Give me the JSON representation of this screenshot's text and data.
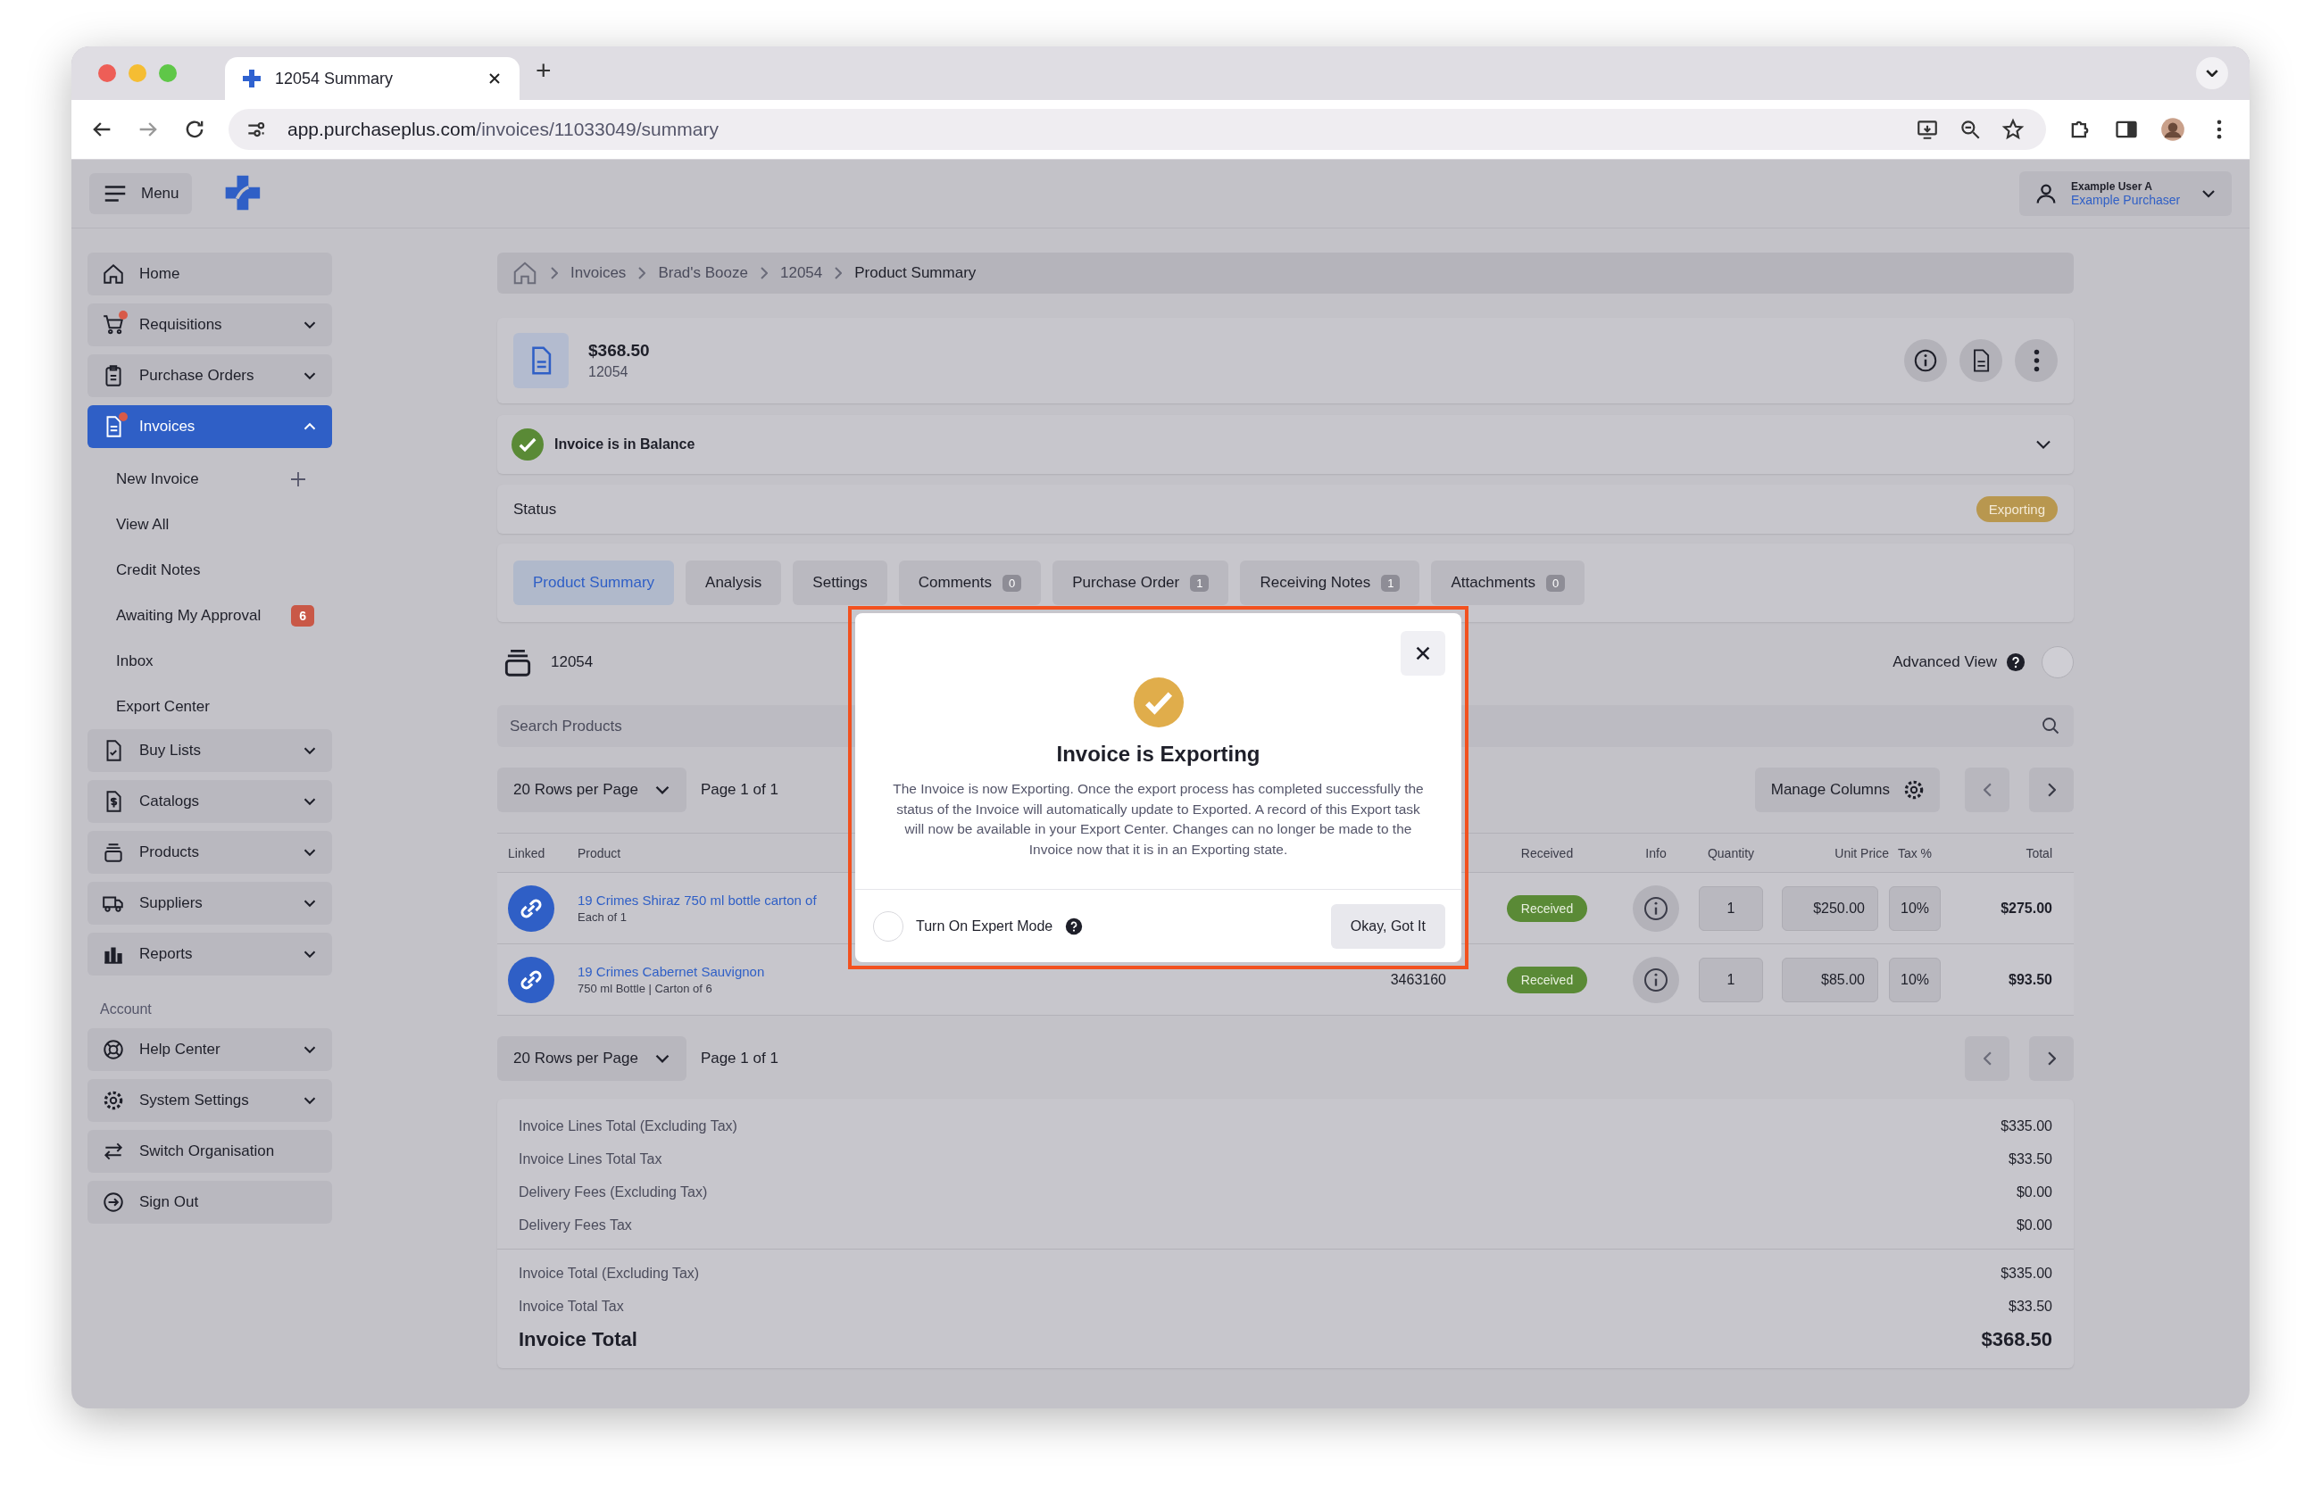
{
  "browser": {
    "tab_title": "12054 Summary",
    "new_tab": "+",
    "url_host": "app.purchaseplus.com",
    "url_path": "/invoices/11033049/summary"
  },
  "header": {
    "menu_label": "Menu",
    "user_name": "Example User A",
    "user_role": "Example Purchaser"
  },
  "sidebar": {
    "items": [
      {
        "label": "Home",
        "kind": "link",
        "selected": false,
        "alert": false
      },
      {
        "label": "Requisitions",
        "kind": "group",
        "expanded": false,
        "selected": false,
        "alert": true
      },
      {
        "label": "Purchase Orders",
        "kind": "group",
        "expanded": false,
        "selected": false,
        "alert": false
      },
      {
        "label": "Invoices",
        "kind": "group",
        "expanded": true,
        "selected": true,
        "alert": true,
        "children": [
          {
            "label": "New Invoice",
            "kind": "add"
          },
          {
            "label": "View All",
            "kind": "link"
          },
          {
            "label": "Credit Notes",
            "kind": "link"
          },
          {
            "label": "Awaiting My Approval",
            "kind": "link",
            "badge": "6"
          },
          {
            "label": "Inbox",
            "kind": "link"
          },
          {
            "label": "Export Center",
            "kind": "link"
          }
        ]
      },
      {
        "label": "Buy Lists",
        "kind": "group",
        "expanded": false,
        "selected": false,
        "alert": false
      },
      {
        "label": "Catalogs",
        "kind": "group",
        "expanded": false,
        "selected": false,
        "alert": false
      },
      {
        "label": "Products",
        "kind": "group",
        "expanded": false,
        "selected": false,
        "alert": false
      },
      {
        "label": "Suppliers",
        "kind": "group",
        "expanded": false,
        "selected": false,
        "alert": false
      },
      {
        "label": "Reports",
        "kind": "group",
        "expanded": false,
        "selected": false,
        "alert": false
      }
    ],
    "account": {
      "heading": "Account",
      "items": [
        {
          "label": "Help Center",
          "kind": "group",
          "expanded": false,
          "selected": false,
          "alert": false
        },
        {
          "label": "System Settings",
          "kind": "group",
          "expanded": false,
          "selected": false,
          "alert": false
        },
        {
          "label": "Switch Organisation",
          "kind": "link",
          "selected": false,
          "alert": false
        },
        {
          "label": "Sign Out",
          "kind": "link",
          "selected": false,
          "alert": false
        }
      ]
    }
  },
  "breadcrumb": [
    "Invoices",
    "Brad's Booze",
    "12054",
    "Product Summary"
  ],
  "invoice": {
    "amount": "$368.50",
    "number": "12054"
  },
  "balance": {
    "label": "Invoice is in Balance",
    "expanded": false
  },
  "status": {
    "label": "Status",
    "badge": "Exporting"
  },
  "tabs": [
    {
      "label": "Product Summary",
      "selected": true
    },
    {
      "label": "Analysis",
      "selected": false
    },
    {
      "label": "Settings",
      "selected": false
    },
    {
      "label": "Comments",
      "count": "0",
      "selected": false
    },
    {
      "label": "Purchase Order",
      "count": "1",
      "selected": false
    },
    {
      "label": "Receiving Notes",
      "count": "1",
      "selected": false
    },
    {
      "label": "Attachments",
      "count": "0",
      "selected": false
    }
  ],
  "products": {
    "title": "12054",
    "advanced_view": {
      "label": "Advanced View",
      "on": false
    },
    "search": {
      "placeholder": "Search Products"
    },
    "pagination_top": {
      "rows": "20 Rows per Page",
      "page": "Page 1 of 1",
      "manage_columns": "Manage Columns"
    },
    "columns": [
      "Linked",
      "Product",
      "Received",
      "Info",
      "Quantity",
      "Unit Price",
      "Tax %",
      "Total"
    ],
    "rows": [
      {
        "linked": true,
        "product": "19 Crimes Shiraz 750 ml bottle carton of",
        "detail": "Each of 1",
        "received": "Received",
        "quantity": "1",
        "unit_price": "$250.00",
        "tax": "10%",
        "total": "$275.00"
      },
      {
        "linked": true,
        "product": "19 Crimes Cabernet Sauvignon",
        "detail": "750 ml Bottle | Carton of 6",
        "code": "3463160",
        "received": "Received",
        "quantity": "1",
        "unit_price": "$85.00",
        "tax": "10%",
        "total": "$93.50"
      }
    ],
    "pagination_bottom": {
      "rows": "20 Rows per Page",
      "page": "Page 1 of 1"
    }
  },
  "totals": {
    "groups": [
      [
        {
          "label": "Invoice Lines Total (Excluding Tax)",
          "value": "$335.00"
        },
        {
          "label": "Invoice Lines Total Tax",
          "value": "$33.50"
        },
        {
          "label": "Delivery Fees (Excluding Tax)",
          "value": "$0.00"
        },
        {
          "label": "Delivery Fees Tax",
          "value": "$0.00"
        }
      ],
      [
        {
          "label": "Invoice Total (Excluding Tax)",
          "value": "$335.00"
        },
        {
          "label": "Invoice Total Tax",
          "value": "$33.50"
        }
      ]
    ],
    "grand": {
      "label": "Invoice Total",
      "value": "$368.50"
    }
  },
  "modal": {
    "title": "Invoice is Exporting",
    "body": "The Invoice is now Exporting. Once the export process has completed successfully the status of the Invoice will automatically update to Exported. A record of this Export task will now be available in your Export Center. Changes can no longer be made to the Invoice now that it is in an Exporting state.",
    "expert_mode": {
      "label": "Turn On Expert Mode",
      "on": false
    },
    "button": "Okay, Got It"
  }
}
